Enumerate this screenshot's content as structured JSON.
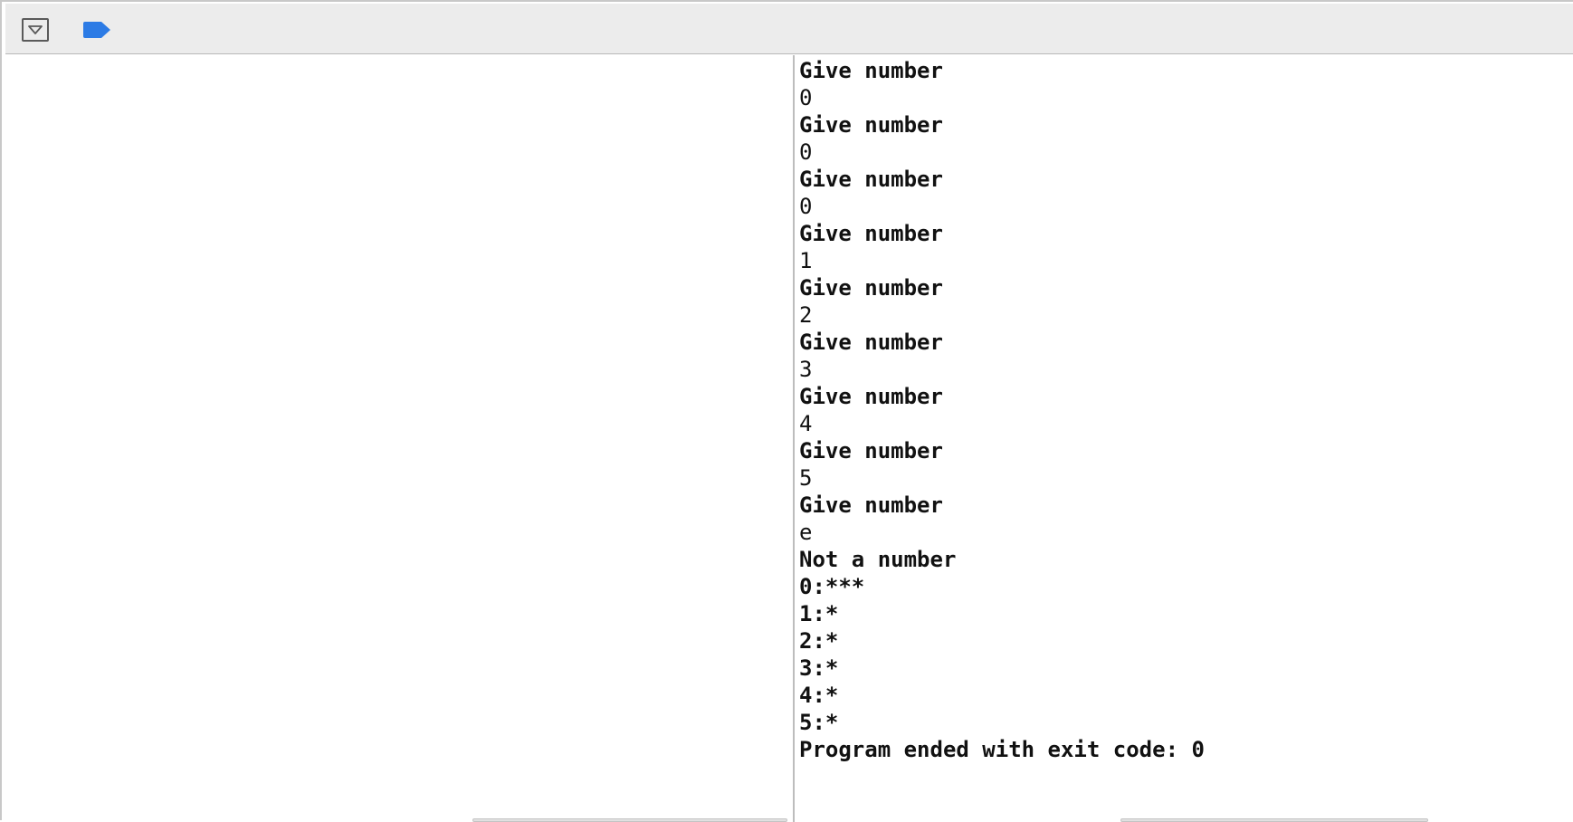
{
  "toolbar": {
    "hide_debug_area_icon": "chevron-down-icon",
    "breakpoints_icon": "breakpoint-icon",
    "accent_color": "#2c7be5"
  },
  "console": {
    "lines": [
      {
        "text": "Give number",
        "kind": "out"
      },
      {
        "text": "0",
        "kind": "in"
      },
      {
        "text": "Give number",
        "kind": "out"
      },
      {
        "text": "0",
        "kind": "in"
      },
      {
        "text": "Give number",
        "kind": "out"
      },
      {
        "text": "0",
        "kind": "in"
      },
      {
        "text": "Give number",
        "kind": "out"
      },
      {
        "text": "1",
        "kind": "in"
      },
      {
        "text": "Give number",
        "kind": "out"
      },
      {
        "text": "2",
        "kind": "in"
      },
      {
        "text": "Give number",
        "kind": "out"
      },
      {
        "text": "3",
        "kind": "in"
      },
      {
        "text": "Give number",
        "kind": "out"
      },
      {
        "text": "4",
        "kind": "in"
      },
      {
        "text": "Give number",
        "kind": "out"
      },
      {
        "text": "5",
        "kind": "in"
      },
      {
        "text": "Give number",
        "kind": "out"
      },
      {
        "text": "e",
        "kind": "in"
      },
      {
        "text": "Not a number",
        "kind": "out"
      },
      {
        "text": "0:***",
        "kind": "out"
      },
      {
        "text": "1:*",
        "kind": "out"
      },
      {
        "text": "2:*",
        "kind": "out"
      },
      {
        "text": "3:*",
        "kind": "out"
      },
      {
        "text": "4:*",
        "kind": "out"
      },
      {
        "text": "5:*",
        "kind": "out"
      },
      {
        "text": "Program ended with exit code: 0",
        "kind": "out"
      }
    ]
  }
}
